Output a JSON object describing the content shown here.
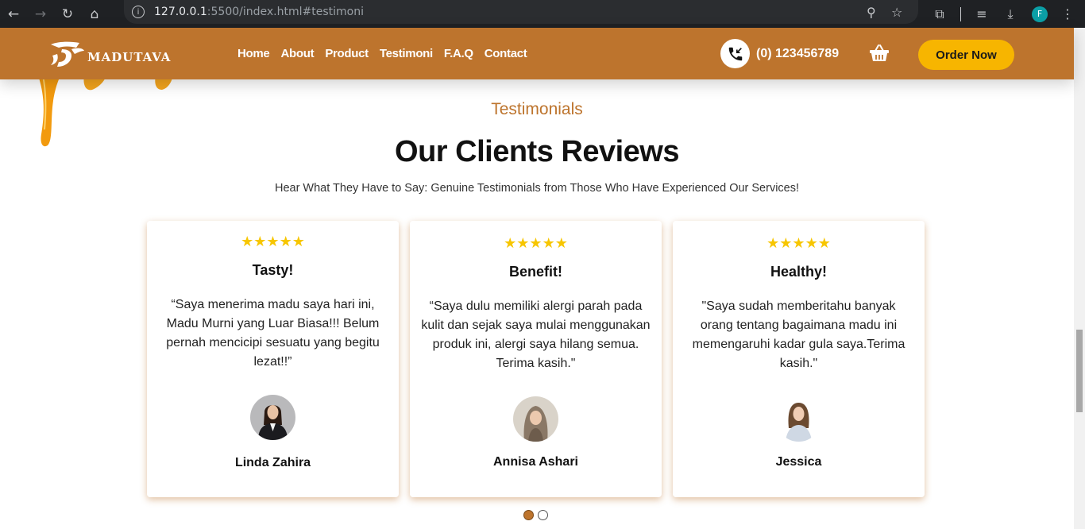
{
  "browser": {
    "url_host": "127.0.0.1",
    "url_rest": ":5500/index.html#testimoni",
    "profile_initial": "F"
  },
  "header": {
    "brand": "MADUTAVA",
    "nav": [
      "Home",
      "About",
      "Product",
      "Testimoni",
      "F.A.Q",
      "Contact"
    ],
    "phone": "(0) 123456789",
    "order_button": "Order Now"
  },
  "section": {
    "label": "Testimonials",
    "title": "Our Clients Reviews",
    "subtitle": "Hear What They Have to Say: Genuine Testimonials from Those Who Have Experienced Our Services!"
  },
  "testimonials": [
    {
      "stars": "★★★★★",
      "rating": 5,
      "title": "Tasty!",
      "quote": "“Saya menerima madu saya hari ini, Madu Murni yang Luar Biasa!!! Belum pernah mencicipi sesuatu yang begitu lezat!!”",
      "name": "Linda Zahira"
    },
    {
      "stars": "★★★★★",
      "rating": 5,
      "title": "Benefit!",
      "quote": "“Saya dulu memiliki alergi parah pada kulit dan sejak saya mulai menggunakan produk ini, alergi saya hilang semua. Terima kasih.\"",
      "name": "Annisa Ashari"
    },
    {
      "stars": "★★★★★",
      "rating": 5,
      "title": "Healthy!",
      "quote": "\"Saya sudah memberitahu banyak orang tentang bagaimana madu ini memengaruhi kadar gula saya.Terima kasih.\"",
      "name": "Jessica"
    }
  ],
  "pagination": {
    "pages": 2,
    "active": 1
  },
  "colors": {
    "brand": "#bd742d",
    "button": "#f7b500",
    "stars": "#f7c600"
  },
  "icons": [
    "back-icon",
    "forward-icon",
    "reload-icon",
    "home-icon",
    "site-info-icon",
    "zoom-icon",
    "bookmark-star-icon",
    "extensions-icon",
    "media-icon",
    "download-icon",
    "menu-icon",
    "phone-icon",
    "basket-icon"
  ]
}
